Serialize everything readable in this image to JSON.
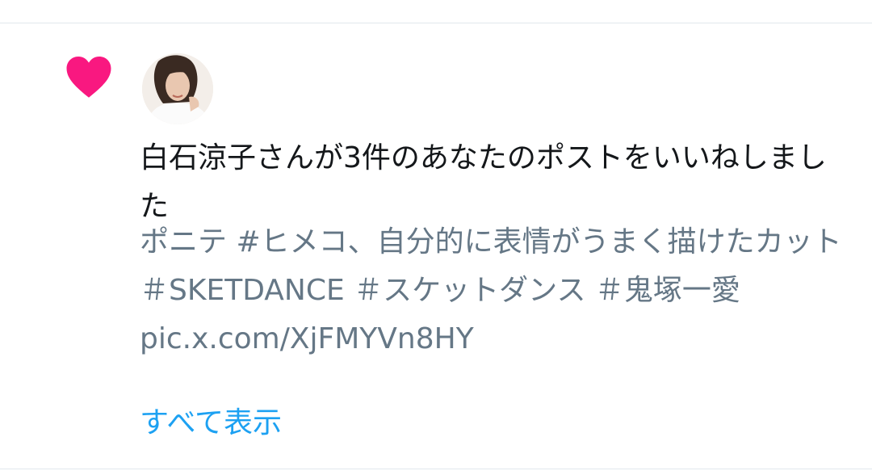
{
  "notification": {
    "icon": "heart-icon",
    "icon_color": "#f91880",
    "message": "白石涼子さんが3件のあなたのポストをいいねしました",
    "post_preview": {
      "lines": [
        "ポニテ #ヒメコ、自分的に表情がうまく描けたカット",
        "＃SKETDANCE ＃スケットダンス ＃鬼塚一愛",
        "pic.x.com/XjFMYVn8HY"
      ]
    },
    "show_all_label": "すべて表示"
  },
  "colors": {
    "primary_text": "#14171a",
    "secondary_text": "#657786",
    "link": "#1da1f2",
    "divider": "#e1e8ed"
  }
}
